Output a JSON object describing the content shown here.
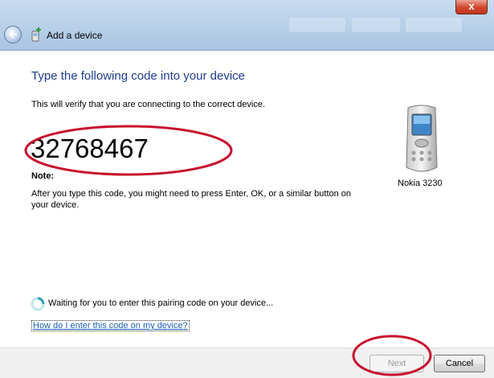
{
  "window": {
    "title": "Add a device",
    "close_label": "x"
  },
  "main": {
    "heading": "Type the following code into your device",
    "verify_text": "This will verify that you are connecting to the correct device.",
    "pairing_code": "32768467",
    "note_label": "Note:",
    "note_text": "After you type this code, you might need to press Enter, OK, or a similar button on your device.",
    "device_name": "Nokia 3230",
    "status_text": "Waiting for you to enter this pairing code on your device...",
    "help_link": "How do I enter this code on my device?"
  },
  "footer": {
    "next_label": "Next",
    "cancel_label": "Cancel"
  },
  "icons": {
    "back": "back-arrow-icon",
    "wizard": "add-device-icon",
    "device": "mobile-phone-icon",
    "status": "spinner-icon"
  },
  "colors": {
    "heading": "#1e3d8f",
    "link": "#1a5fb4",
    "annotation": "#c8102e",
    "close_button": "#d1472c"
  }
}
